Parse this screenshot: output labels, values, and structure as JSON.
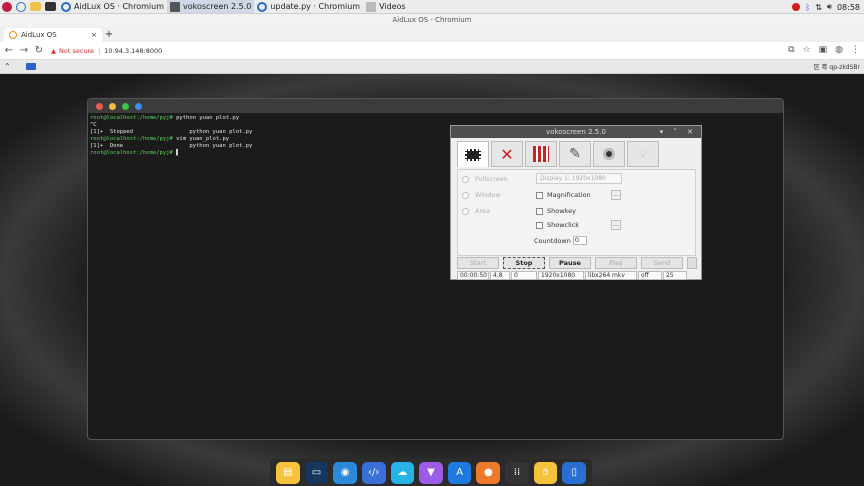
{
  "taskbar": {
    "tasks": [
      {
        "label": "AidLux OS · Chromium"
      },
      {
        "label": "vokoscreen 2.5.0"
      },
      {
        "label": "update.py · Chromium"
      },
      {
        "label": "Videos"
      }
    ],
    "clock": "08:58"
  },
  "chrome": {
    "window_title": "AidLux OS - Chromium",
    "tab_title": "AidLux OS",
    "security_label": "Not secure",
    "url": "10.94.3.148:8000",
    "new_tab": "+",
    "close_tab": "×"
  },
  "remote": {
    "right_text": "区 粤 qp-zkdSBr"
  },
  "terminal": {
    "lines": [
      {
        "prompt": "root@localhost:/home/pyj#",
        "cmd": " python yuan plot.py"
      },
      {
        "prompt": "",
        "cmd": "^C"
      },
      {
        "prompt": "",
        "cmd": "[1]+  Stopped                 python yuan plot.py"
      },
      {
        "prompt": "root@localhost:/home/pyj#",
        "cmd": " vim yuan_plot.py"
      },
      {
        "prompt": "",
        "cmd": "[1]+  Done                    python yuan plot.py"
      },
      {
        "prompt": "root@localhost:/home/pyj#",
        "cmd": " ▌"
      }
    ]
  },
  "voko": {
    "title": "vokoscreen 2.5.0",
    "fullscreen": "Fullscreen",
    "window": "Window",
    "area": "Area",
    "display_combo": "Display 1: 1920x1080",
    "magnification": "Magnification",
    "showkey": "Showkey",
    "showclick": "Showclick",
    "countdown_label": "Countdown",
    "countdown_value": "0",
    "dots": "...",
    "buttons": {
      "start": "Start",
      "stop": "Stop",
      "pause": "Pause",
      "play": "Play",
      "send": "Send"
    },
    "status": [
      "00:00:50",
      "4.8",
      "0",
      "1920x1080",
      "libx264 mkv",
      "off",
      "25"
    ]
  }
}
